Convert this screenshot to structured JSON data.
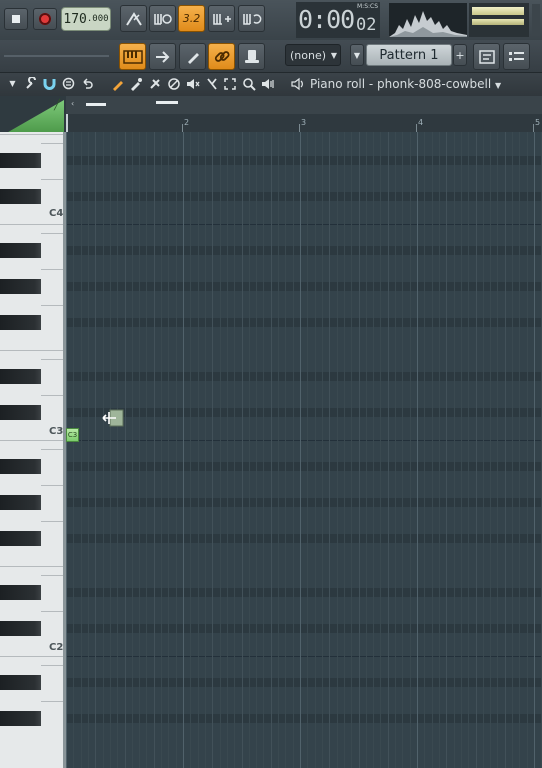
{
  "toolbar": {
    "tempo_int": "170",
    "tempo_dec": ".000",
    "snap_label": "3.2",
    "time_main": "0:00",
    "time_sub": "02",
    "time_unit": "M:S:CS",
    "pattern_select": "(none)",
    "pattern_name": "Pattern 1",
    "pattern_add": "+"
  },
  "piano_roll": {
    "title": "Piano roll - phonk-808-cowbell",
    "bar_numbers": [
      "2",
      "3",
      "4",
      "5"
    ],
    "octave_labels": [
      "C4",
      "C3",
      "C2"
    ],
    "note_label": "C3"
  },
  "colors": {
    "accent_orange": "#f3a43a",
    "record_red": "#e03a3a",
    "note_green": "#7dcc6d",
    "grid_bg": "#34434b"
  }
}
